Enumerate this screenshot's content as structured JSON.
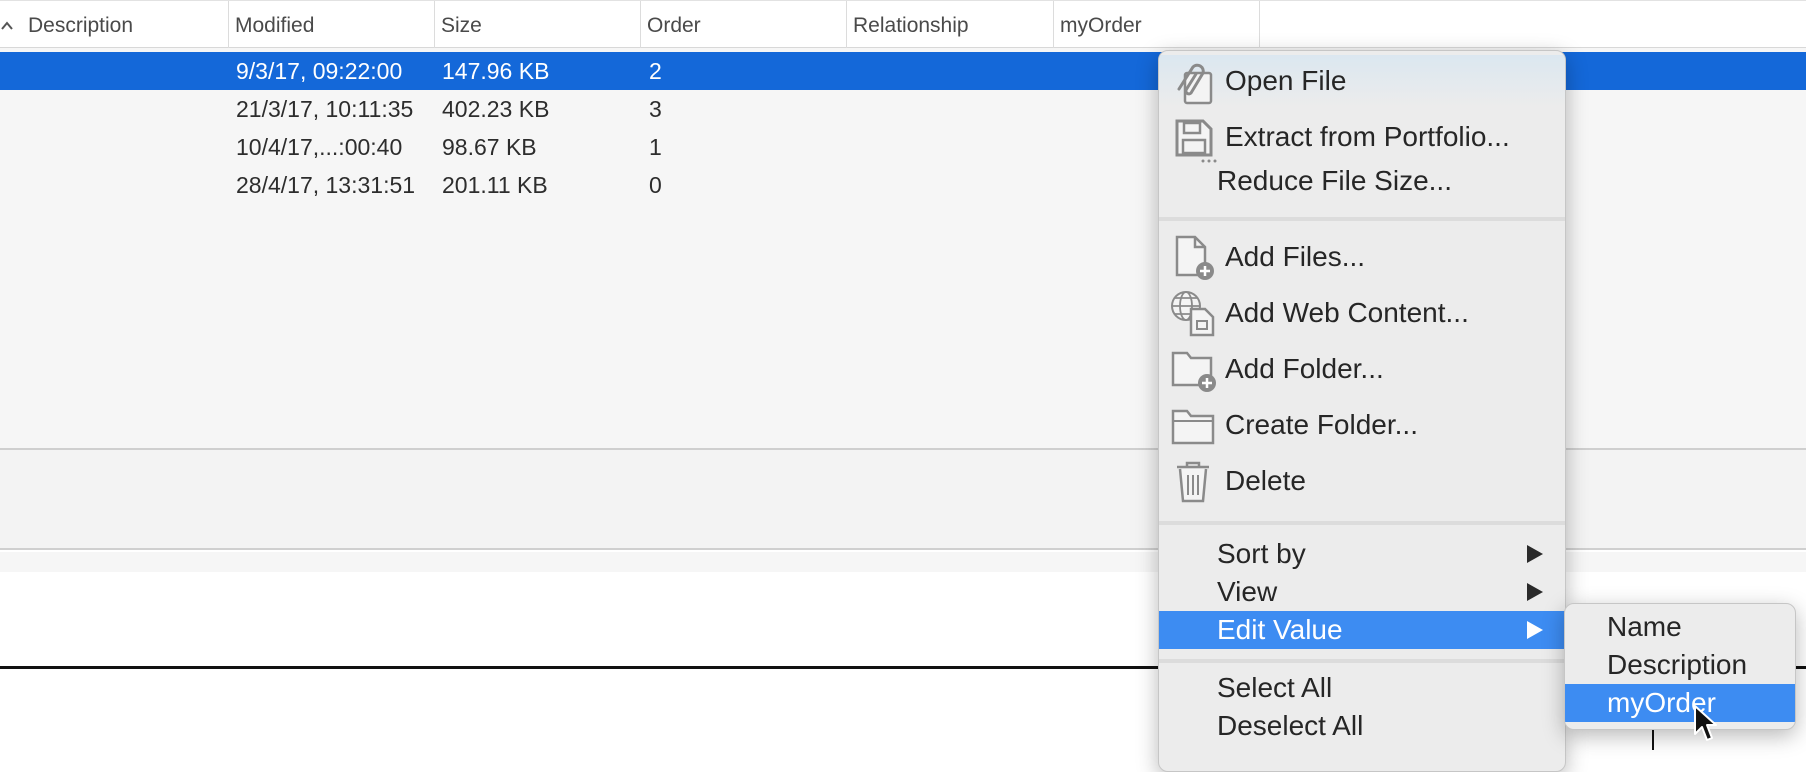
{
  "table": {
    "columns": [
      "Description",
      "Modified",
      "Size",
      "Order",
      "Relationship",
      "myOrder"
    ],
    "rows": [
      {
        "description": "",
        "modified": "9/3/17, 09:22:00",
        "size": "147.96 KB",
        "order": "2",
        "relationship": "",
        "myorder": ""
      },
      {
        "description": "",
        "modified": "21/3/17, 10:11:35",
        "size": "402.23 KB",
        "order": "3",
        "relationship": "",
        "myorder": ""
      },
      {
        "description": "",
        "modified": "10/4/17,...:00:40",
        "size": "98.67 KB",
        "order": "1",
        "relationship": "",
        "myorder": ""
      },
      {
        "description": "",
        "modified": "28/4/17, 13:31:51",
        "size": "201.11 KB",
        "order": "0",
        "relationship": "",
        "myorder": ""
      }
    ],
    "selected_row": 0
  },
  "context_menu": {
    "items": [
      {
        "label": "Open File",
        "icon": "paperclip-file-icon"
      },
      {
        "label": "Extract from Portfolio...",
        "icon": "floppy-disk-icon"
      },
      {
        "label": "Reduce File Size...",
        "icon": ""
      },
      {
        "label": "Add Files...",
        "icon": "add-file-icon"
      },
      {
        "label": "Add Web Content...",
        "icon": "globe-file-icon"
      },
      {
        "label": "Add Folder...",
        "icon": "add-folder-icon"
      },
      {
        "label": "Create Folder...",
        "icon": "folder-icon"
      },
      {
        "label": "Delete",
        "icon": "trash-icon"
      },
      {
        "label": "Sort by",
        "icon": ""
      },
      {
        "label": "View",
        "icon": ""
      },
      {
        "label": "Edit Value",
        "icon": ""
      },
      {
        "label": "Select All",
        "icon": ""
      },
      {
        "label": "Deselect All",
        "icon": ""
      }
    ]
  },
  "submenu": {
    "items": [
      "Name",
      "Description",
      "myOrder"
    ],
    "active_index": 2
  },
  "colors": {
    "selection_blue": "#1468d9",
    "menu_highlight": "#3d8cf2",
    "menu_bg": "#ececec",
    "icon_gray": "#8a8a8a"
  }
}
